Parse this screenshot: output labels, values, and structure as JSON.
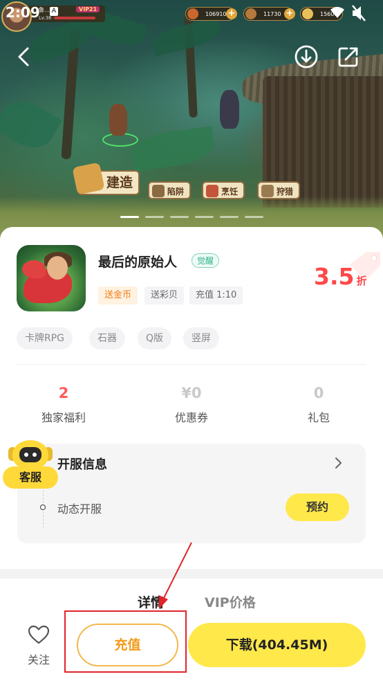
{
  "status_bar": {
    "time": "2:09"
  },
  "game_hud": {
    "player_name": "鲁…人",
    "vip": "VIP21",
    "level": "Lv.36",
    "resources": [
      "106910",
      "11730",
      "15600"
    ]
  },
  "banner": {
    "skill_buttons": [
      "建造",
      "陷阱",
      "烹饪",
      "狩猎"
    ],
    "slide_count": 6,
    "active_slide": 0
  },
  "app": {
    "name": "最后的原始人",
    "status_tag": "觉醒",
    "perks": [
      "送金币",
      "送彩贝",
      "充值 1:10"
    ],
    "discount_value": "3.5",
    "discount_unit": "折",
    "tags": [
      "卡牌RPG",
      "石器",
      "Q版",
      "竖屏"
    ]
  },
  "stats": [
    {
      "value": "2",
      "label": "独家福利"
    },
    {
      "value": "¥0",
      "label": "优惠券"
    },
    {
      "value": "0",
      "label": "礼包"
    }
  ],
  "server": {
    "title": "开服信息",
    "item": "动态开服",
    "reserve_label": "预约"
  },
  "customer_service": {
    "label": "客服"
  },
  "tabs": [
    "详情",
    "VIP价格"
  ],
  "bottom_bar": {
    "follow_label": "关注",
    "recharge_label": "充值",
    "download_label": "下载(404.45M)"
  },
  "colors": {
    "accent_yellow": "#ffe84a",
    "discount_red": "#ff4848",
    "recharge_orange": "#f29a19",
    "highlight_red": "#e0242a"
  }
}
